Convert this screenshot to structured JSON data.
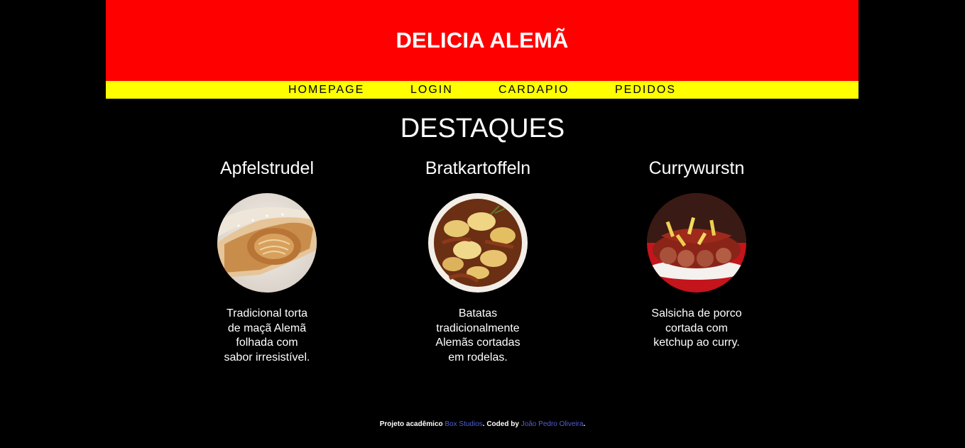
{
  "header": {
    "title": "DELICIA ALEMÃ"
  },
  "nav": {
    "items": [
      {
        "label": "HOMEPAGE"
      },
      {
        "label": "LOGIN"
      },
      {
        "label": "CARDAPIO"
      },
      {
        "label": "PEDIDOS"
      }
    ]
  },
  "main": {
    "section_title": "DESTAQUES",
    "cards": [
      {
        "title": "Apfelstrudel",
        "image_alt": "apfelstrudel-photo",
        "description": "Tradicional torta de maçã Alemã folhada com sabor irresistível."
      },
      {
        "title": "Bratkartoffeln",
        "image_alt": "bratkartoffeln-photo",
        "description": "Batatas tradicionalmente Alemãs cortadas em rodelas."
      },
      {
        "title": "Currywurstn",
        "image_alt": "currywurst-photo",
        "description": "Salsicha de porco cortada com ketchup ao curry."
      }
    ]
  },
  "footer": {
    "prefix": "Projeto acadêmico ",
    "studio_link": "Box Studios",
    "middle": ". Coded by ",
    "author_link": "João Pedro Oliveira",
    "suffix": "."
  },
  "colors": {
    "header_bg": "#ff0000",
    "nav_bg": "#ffff00",
    "page_bg": "#000000",
    "link": "#4f5fd6"
  }
}
